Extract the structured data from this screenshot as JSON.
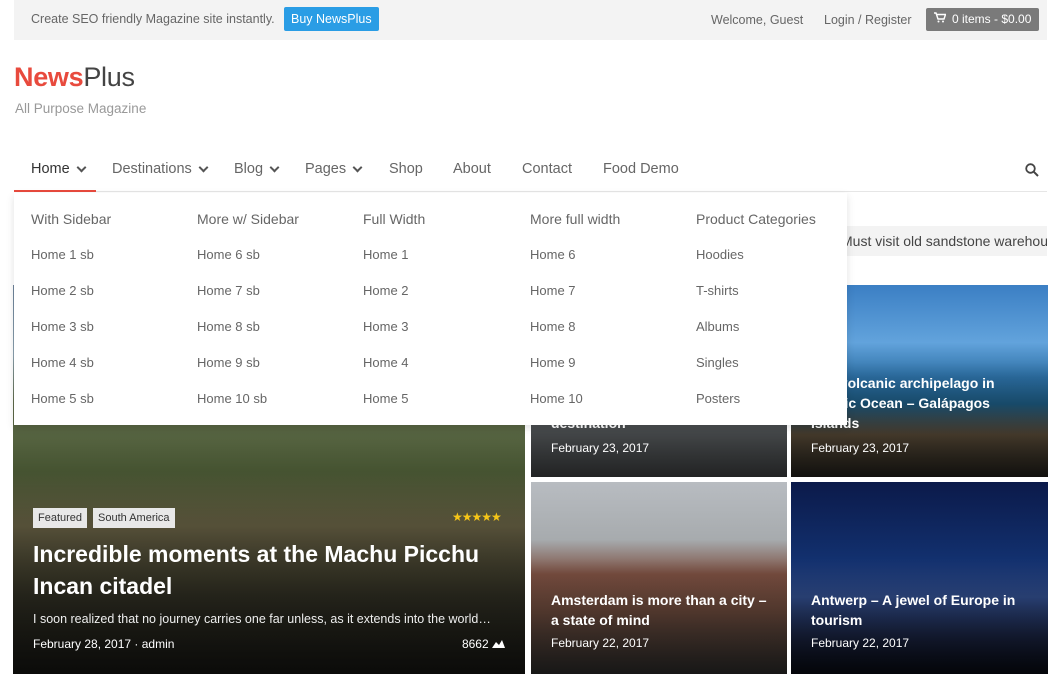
{
  "topbar": {
    "promo": "Create SEO friendly Magazine site instantly.",
    "buy_label": "Buy NewsPlus",
    "welcome": "Welcome, Guest",
    "login": "Login / Register",
    "cart": "0 items - $0.00"
  },
  "logo": {
    "news": "News",
    "plus": "Plus",
    "tagline": "All Purpose Magazine"
  },
  "nav": {
    "items": [
      "Home",
      "Destinations",
      "Blog",
      "Pages",
      "Shop",
      "About",
      "Contact",
      "Food Demo"
    ]
  },
  "mega": {
    "columns": [
      {
        "head": "With Sidebar",
        "links": [
          "Home 1 sb",
          "Home 2 sb",
          "Home 3 sb",
          "Home 4 sb",
          "Home 5 sb"
        ]
      },
      {
        "head": "More w/ Sidebar",
        "links": [
          "Home 6 sb",
          "Home 7 sb",
          "Home 8 sb",
          "Home 9 sb",
          "Home 10 sb"
        ]
      },
      {
        "head": "Full Width",
        "links": [
          "Home 1",
          "Home 2",
          "Home 3",
          "Home 4",
          "Home 5"
        ]
      },
      {
        "head": "More full width",
        "links": [
          "Home 6",
          "Home 7",
          "Home 8",
          "Home 9",
          "Home 10"
        ]
      },
      {
        "head": "Product Categories",
        "links": [
          "Hoodies",
          "T-shirts",
          "Albums",
          "Singles",
          "Posters"
        ]
      }
    ]
  },
  "ticker": {
    "text": "Must visit old sandstone warehouses"
  },
  "featured": {
    "badges": [
      "Featured",
      "South America"
    ],
    "rating": 5,
    "title": "Incredible moments at the Machu Picchu Incan citadel",
    "excerpt": "I soon realized that no journey carries one far unless, as it extends into the world…",
    "date": "February 28, 2017",
    "author": "admin",
    "views": "8662"
  },
  "tiles": [
    {
      "title": "destination",
      "date": "February 23, 2017"
    },
    {
      "title": "The volcanic archipelago in Pacific Ocean – Galápagos Islands",
      "date": "February 23, 2017"
    },
    {
      "title": "Amsterdam is more than a city – a state of mind",
      "date": "February 22, 2017"
    },
    {
      "title": "Antwerp – A jewel of Europe in tourism",
      "date": "February 22, 2017"
    }
  ]
}
